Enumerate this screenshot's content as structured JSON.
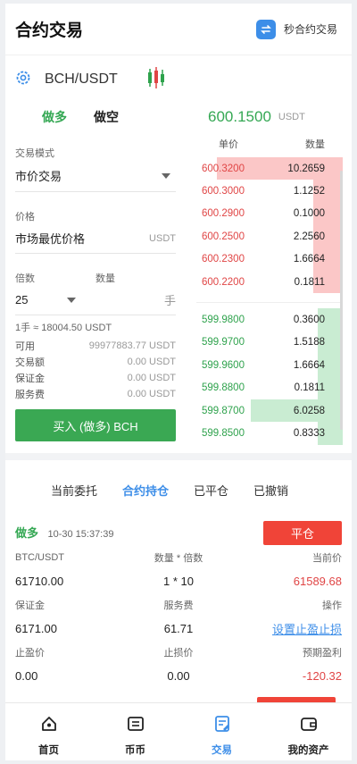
{
  "header": {
    "title": "合约交易",
    "second_contract_label": "秒合约交易"
  },
  "pair": {
    "name": "BCH/USDT"
  },
  "trade_tabs": {
    "buy": "做多",
    "sell": "做空"
  },
  "form": {
    "mode_label": "交易模式",
    "mode_value": "市价交易",
    "price_label": "价格",
    "price_value": "市场最优价格",
    "price_unit": "USDT",
    "leverage_label": "倍数",
    "quantity_label": "数量",
    "leverage_value": "25",
    "quantity_unit": "手",
    "lot_info": "1手 ≈ 18004.50 USDT",
    "rows": [
      {
        "k": "可用",
        "v": "99977883.77 USDT"
      },
      {
        "k": "交易额",
        "v": "0.00 USDT"
      },
      {
        "k": "保证金",
        "v": "0.00 USDT"
      },
      {
        "k": "服务费",
        "v": "0.00 USDT"
      }
    ],
    "buy_button": "买入 (做多) BCH"
  },
  "orderbook": {
    "current_price": "600.1500",
    "current_unit": "USDT",
    "col_price": "单价",
    "col_qty": "数量",
    "asks": [
      {
        "price": "600.3200",
        "qty": "10.2659",
        "depth": 0.86
      },
      {
        "price": "600.3000",
        "qty": "1.1252",
        "depth": 0.2
      },
      {
        "price": "600.2900",
        "qty": "0.1000",
        "depth": 0.2
      },
      {
        "price": "600.2500",
        "qty": "2.2560",
        "depth": 0.2
      },
      {
        "price": "600.2300",
        "qty": "1.6664",
        "depth": 0.2
      },
      {
        "price": "600.2200",
        "qty": "0.1811",
        "depth": 0.2
      }
    ],
    "bids": [
      {
        "price": "599.9800",
        "qty": "0.3600",
        "depth": 0.17
      },
      {
        "price": "599.9700",
        "qty": "1.5188",
        "depth": 0.17
      },
      {
        "price": "599.9600",
        "qty": "1.6664",
        "depth": 0.17
      },
      {
        "price": "599.8800",
        "qty": "0.1811",
        "depth": 0.17
      },
      {
        "price": "599.8700",
        "qty": "6.0258",
        "depth": 0.63
      },
      {
        "price": "599.8500",
        "qty": "0.8333",
        "depth": 0.17
      }
    ]
  },
  "order_tabs": [
    "当前委托",
    "合约持仓",
    "已平仓",
    "已撤销"
  ],
  "order_tabs_active": 1,
  "position": {
    "direction": "做多",
    "time": "10-30 15:37:39",
    "close_button": "平仓",
    "row1_labels": [
      "BTC/USDT",
      "数量 * 倍数",
      "当前价"
    ],
    "row1_values": [
      "61710.00",
      "1 * 10",
      "61589.68"
    ],
    "row2_labels": [
      "保证金",
      "服务费",
      "操作"
    ],
    "row2_values": [
      "6171.00",
      "61.71",
      "设置止盈止损"
    ],
    "row3_labels": [
      "止盈价",
      "止损价",
      "预期盈利"
    ],
    "row3_values": [
      "0.00",
      "0.00",
      "-120.32"
    ]
  },
  "tabbar": [
    {
      "label": "首页",
      "icon": "home-icon"
    },
    {
      "label": "币币",
      "icon": "exchange-icon"
    },
    {
      "label": "交易",
      "icon": "trade-icon"
    },
    {
      "label": "我的资产",
      "icon": "wallet-icon"
    }
  ],
  "tabbar_active": 2,
  "colors": {
    "green": "#35a854",
    "red": "#e04545",
    "blue": "#3d8ee8"
  }
}
